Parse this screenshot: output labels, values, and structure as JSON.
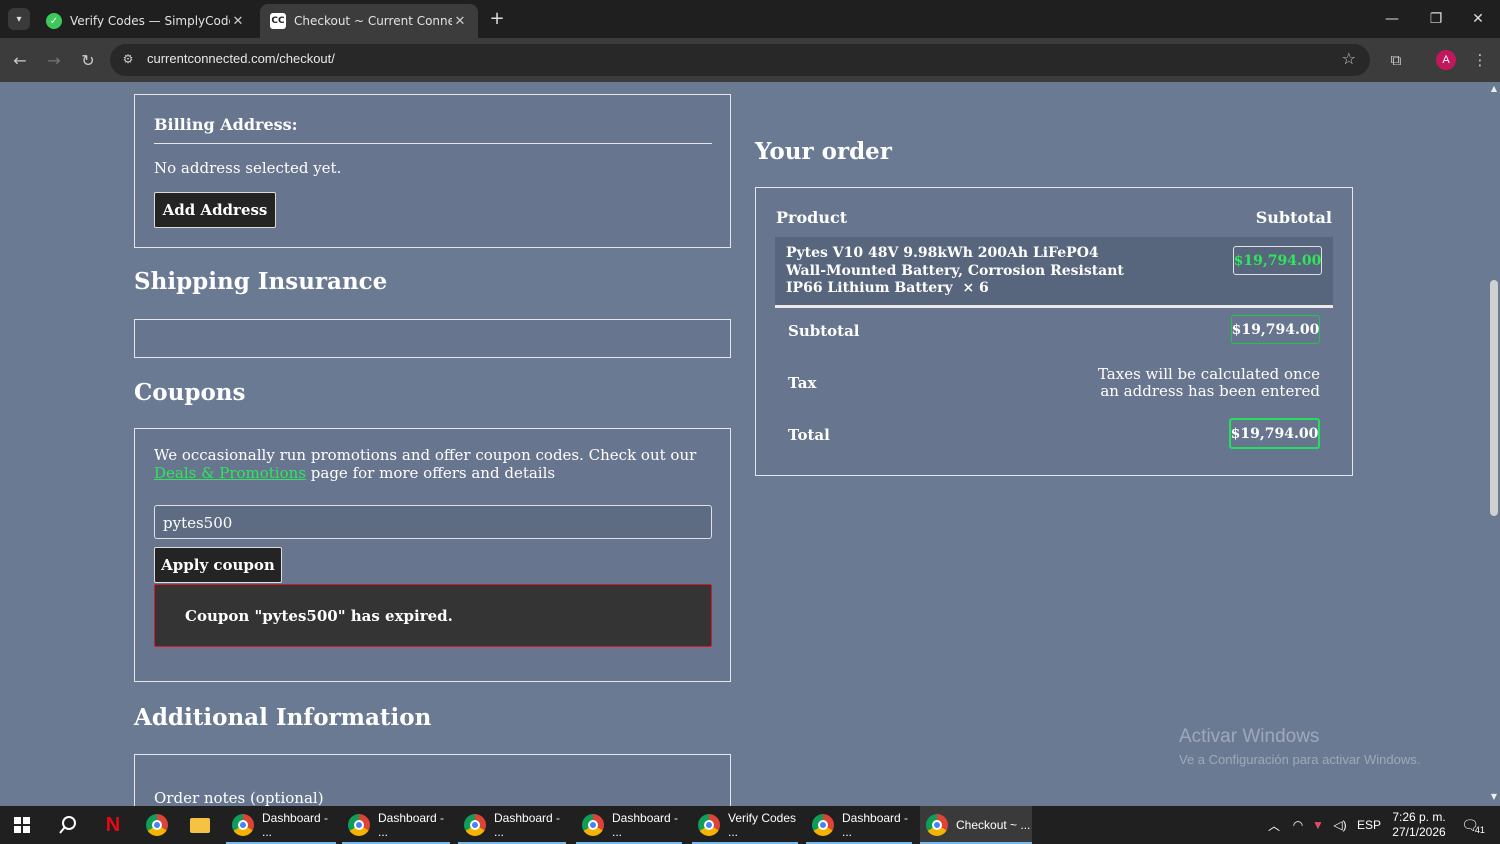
{
  "browser": {
    "tabs": [
      {
        "title": "Verify Codes — SimplyCodes",
        "favicon": "simplycodes-icon",
        "active": false
      },
      {
        "title": "Checkout ~ Current Connected",
        "favicon": "currentconnected-icon",
        "active": true
      }
    ],
    "url": "currentconnected.com/checkout/",
    "profile_initial": "A"
  },
  "billing": {
    "heading": "Billing Address:",
    "empty_text": "No address selected yet.",
    "add_button": "Add Address"
  },
  "shipping": {
    "heading": "Shipping Insurance"
  },
  "coupons": {
    "heading": "Coupons",
    "intro_text": "We occasionally run promotions and offer coupon codes. Check out our",
    "link_text": "Deals & Promotions",
    "intro_tail": "page for more offers and details",
    "code_value": "pytes500",
    "apply_button": "Apply coupon",
    "error_message": "Coupon \"pytes500\" has expired."
  },
  "additional": {
    "heading": "Additional Information",
    "order_notes_label": "Order notes (optional)"
  },
  "order": {
    "heading": "Your order",
    "col_product": "Product",
    "col_subtotal": "Subtotal",
    "item_name_line1": "Pytes V10 48V 9.98kWh 200Ah LiFePO4",
    "item_name_line2": "Wall-Mounted Battery, Corrosion Resistant",
    "item_name_line3": "IP66 Lithium Battery",
    "item_qty": "× 6",
    "item_price": "$19,794.00",
    "subtotal_label": "Subtotal",
    "subtotal_value": "$19,794.00",
    "tax_label": "Tax",
    "tax_note_line1": "Taxes will be calculated once",
    "tax_note_line2": "an address has been entered",
    "total_label": "Total",
    "total_value": "$19,794.00"
  },
  "watermark": {
    "line1": "Activar Windows",
    "line2": "Ve a Configuración para activar Windows."
  },
  "taskbar": {
    "apps": [
      {
        "label": "Dashboard - ..."
      },
      {
        "label": "Dashboard - ..."
      },
      {
        "label": "Dashboard - ..."
      },
      {
        "label": "Dashboard - ..."
      },
      {
        "label": "Verify Codes ..."
      },
      {
        "label": "Dashboard - ..."
      },
      {
        "label": "Checkout ~ ..."
      }
    ],
    "language": "ESP",
    "time": "7:26 p. m.",
    "date": "27/1/2026",
    "notifications": "41"
  },
  "colors": {
    "page_bg": "#6a7a92",
    "accent_green": "#22e05a",
    "error_border": "#d11a2a"
  }
}
